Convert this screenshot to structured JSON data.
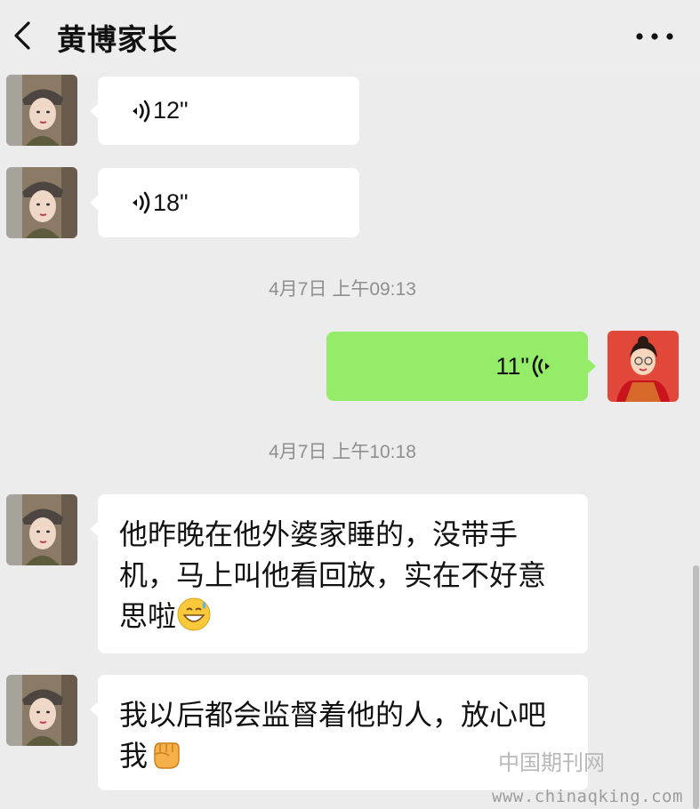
{
  "header": {
    "title": "黄博家长"
  },
  "messages": [
    {
      "voice_duration": "12\""
    },
    {
      "voice_duration": "18\""
    },
    {
      "timestamp": "4月7日 上午09:13"
    },
    {
      "voice_duration": "11\""
    },
    {
      "timestamp": "4月7日 上午10:18"
    },
    {
      "text": "他昨晚在他外婆家睡的，没带手机，马上叫他看回放，实在不好意思啦"
    },
    {
      "text": "我以后都会监督着他的人，放心吧我"
    }
  ],
  "watermark": {
    "site_name": "中国期刊网",
    "url": "www.chinaqking.com"
  },
  "colors": {
    "background": "#ececec",
    "self_bubble": "#95ec69",
    "other_bubble": "#ffffff",
    "timestamp": "#8f8f8f"
  },
  "icons": {
    "back": "chevron-left-icon",
    "more": "more-dots-icon",
    "voice": "voice-wave-icon",
    "emoji_1": "grinning-sweat-emoji",
    "emoji_2": "raised-fist-emoji"
  }
}
